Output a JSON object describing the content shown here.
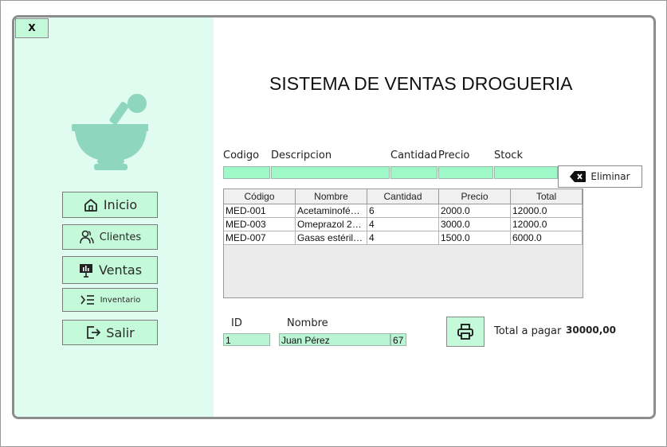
{
  "window": {
    "close_label": "X"
  },
  "sidebar": {
    "logo_icon": "mortar-pestle-icon",
    "nav": [
      {
        "label": "Inicio",
        "icon": "home-icon"
      },
      {
        "label": "Clientes",
        "icon": "users-icon"
      },
      {
        "label": "Ventas",
        "icon": "presentation-icon"
      },
      {
        "label": "Inventario",
        "icon": "list-icon"
      },
      {
        "label": "Salir",
        "icon": "logout-icon"
      }
    ]
  },
  "main": {
    "title": "SISTEMA DE VENTAS DROGUERIA",
    "labels": {
      "codigo": "Codigo",
      "descripcion": "Descripcion",
      "cantidad": "Cantidad",
      "precio": "Precio",
      "stock": "Stock"
    },
    "inputs": {
      "codigo": "",
      "descripcion": "",
      "cantidad": "",
      "precio": "",
      "stock": ""
    },
    "delete_button": {
      "label": "Eliminar",
      "icon": "backspace-icon"
    }
  },
  "table": {
    "columns": [
      "Código",
      "Nombre",
      "Cantidad",
      "Precio",
      "Total"
    ],
    "rows": [
      [
        "MED-001",
        "Acetaminofén ...",
        "6",
        "2000.0",
        "12000.0"
      ],
      [
        "MED-003",
        "Omeprazol 20...",
        "4",
        "3000.0",
        "12000.0"
      ],
      [
        "MED-007",
        "Gasas estérile...",
        "4",
        "1500.0",
        "6000.0"
      ]
    ]
  },
  "client": {
    "id_label": "ID",
    "nombre_label": "Nombre",
    "id_value": "1",
    "nombre_value": "Juan Pérez",
    "extra_value": "67"
  },
  "footer": {
    "print_icon": "printer-icon",
    "total_label": "Total a pagar",
    "total_value": "30000,00"
  },
  "colors": {
    "sidebar": "#e0fcf0",
    "accent": "#c4fad9",
    "field": "#9ef8c8",
    "logo": "#8fd6bf"
  }
}
